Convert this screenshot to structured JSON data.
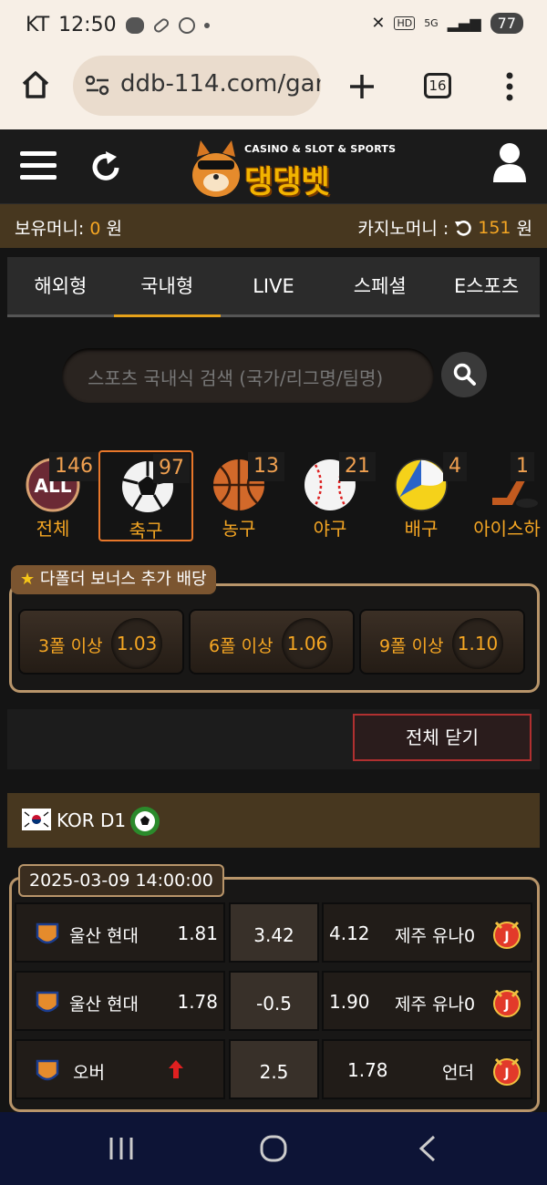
{
  "status": {
    "carrier": "KT",
    "time": "12:50",
    "battery": "77"
  },
  "browser": {
    "url": "ddb-114.com/gar",
    "tab_count": "16"
  },
  "brand": {
    "subtitle": "CASINO & SLOT & SPORTS",
    "name": "댕댕벳"
  },
  "balance": {
    "money_label": "보유머니:",
    "money_value": "0",
    "money_unit": "원",
    "casino_label": "카지노머니 :",
    "casino_value": "151",
    "casino_unit": "원"
  },
  "tabs": [
    "해외형",
    "국내형",
    "LIVE",
    "스페셜",
    "E스포츠"
  ],
  "search": {
    "placeholder": "스포츠 국내식 검색 (국가/리그명/팀명)"
  },
  "sports": [
    {
      "label": "전체",
      "count": "146"
    },
    {
      "label": "축구",
      "count": "97"
    },
    {
      "label": "농구",
      "count": "13"
    },
    {
      "label": "야구",
      "count": "21"
    },
    {
      "label": "배구",
      "count": "4"
    },
    {
      "label": "아이스하",
      "count": "1"
    }
  ],
  "bonus": {
    "title": "다폴더 보너스 추가 배당",
    "items": [
      {
        "label": "3폴 이상",
        "value": "1.03"
      },
      {
        "label": "6폴 이상",
        "value": "1.06"
      },
      {
        "label": "9폴 이상",
        "value": "1.10"
      }
    ]
  },
  "close_all": "전체 닫기",
  "league": {
    "name": "KOR D1"
  },
  "match": {
    "datetime": "2025-03-09 14:00:00",
    "rows": [
      {
        "home": "울산 현대",
        "home_odd": "1.81",
        "mid": "3.42",
        "away_odd": "4.12",
        "away": "제주 유나0"
      },
      {
        "home": "울산 현대",
        "home_odd": "1.78",
        "mid": "-0.5",
        "away_odd": "1.90",
        "away": "제주 유나0"
      },
      {
        "home": "오버",
        "home_odd": "",
        "mid": "2.5",
        "away_odd": "1.78",
        "away": "언더"
      }
    ]
  }
}
